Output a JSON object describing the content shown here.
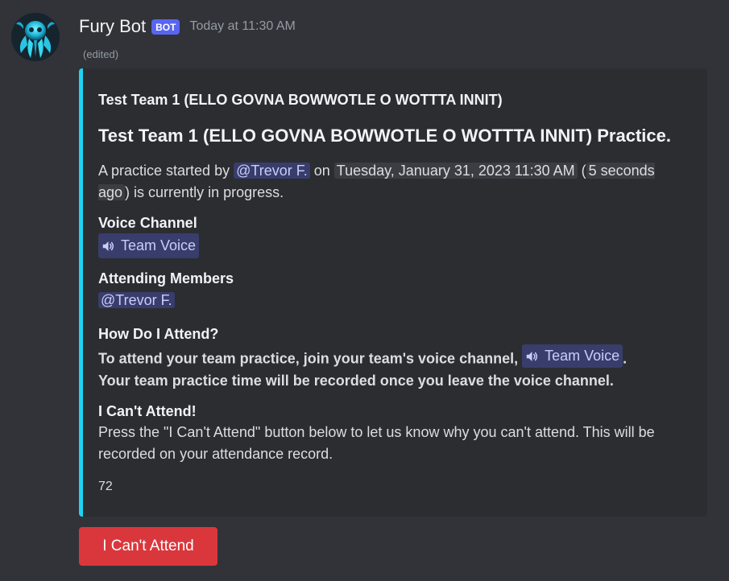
{
  "message": {
    "author": "Fury Bot",
    "bot_tag": "BOT",
    "timestamp": "Today at 11:30 AM",
    "edited": "(edited)"
  },
  "embed": {
    "accent_color": "#1fd2f2",
    "author_name": "Test Team 1 (ELLO GOVNA BOWWOTLE O WOTTTA INNIT)",
    "title": "Test Team 1 (ELLO GOVNA BOWWOTLE O WOTTTA INNIT) Practice.",
    "description": {
      "prefix": "A practice started by ",
      "mention": "@Trevor F.",
      "on": " on ",
      "date": "Tuesday, January 31, 2023 11:30 AM",
      "open_paren": " (",
      "relative": "5 seconds ago",
      "suffix": ") is currently in progress."
    },
    "fields": {
      "voice_channel": {
        "name": "Voice Channel",
        "channel": "Team Voice"
      },
      "attending_members": {
        "name": "Attending Members",
        "member": "@Trevor F."
      },
      "how_to_attend": {
        "name": "How Do I Attend?",
        "line1_prefix": "To attend your team practice, join your team's voice channel, ",
        "channel": "Team Voice",
        "line1_suffix": ".",
        "line2": "Your team practice time will be recorded once you leave the voice channel."
      },
      "cant_attend": {
        "name": "I Can't Attend!",
        "value": "Press the \"I Can't Attend\" button below to let us know why you can't attend. This will be recorded on your attendance record."
      }
    },
    "footer": "72"
  },
  "buttons": {
    "cant_attend": "I Can't Attend",
    "cant_attend_color": "#da373c"
  },
  "icons": {
    "avatar": "octopus-avatar-icon",
    "channel": "speaker-icon"
  }
}
